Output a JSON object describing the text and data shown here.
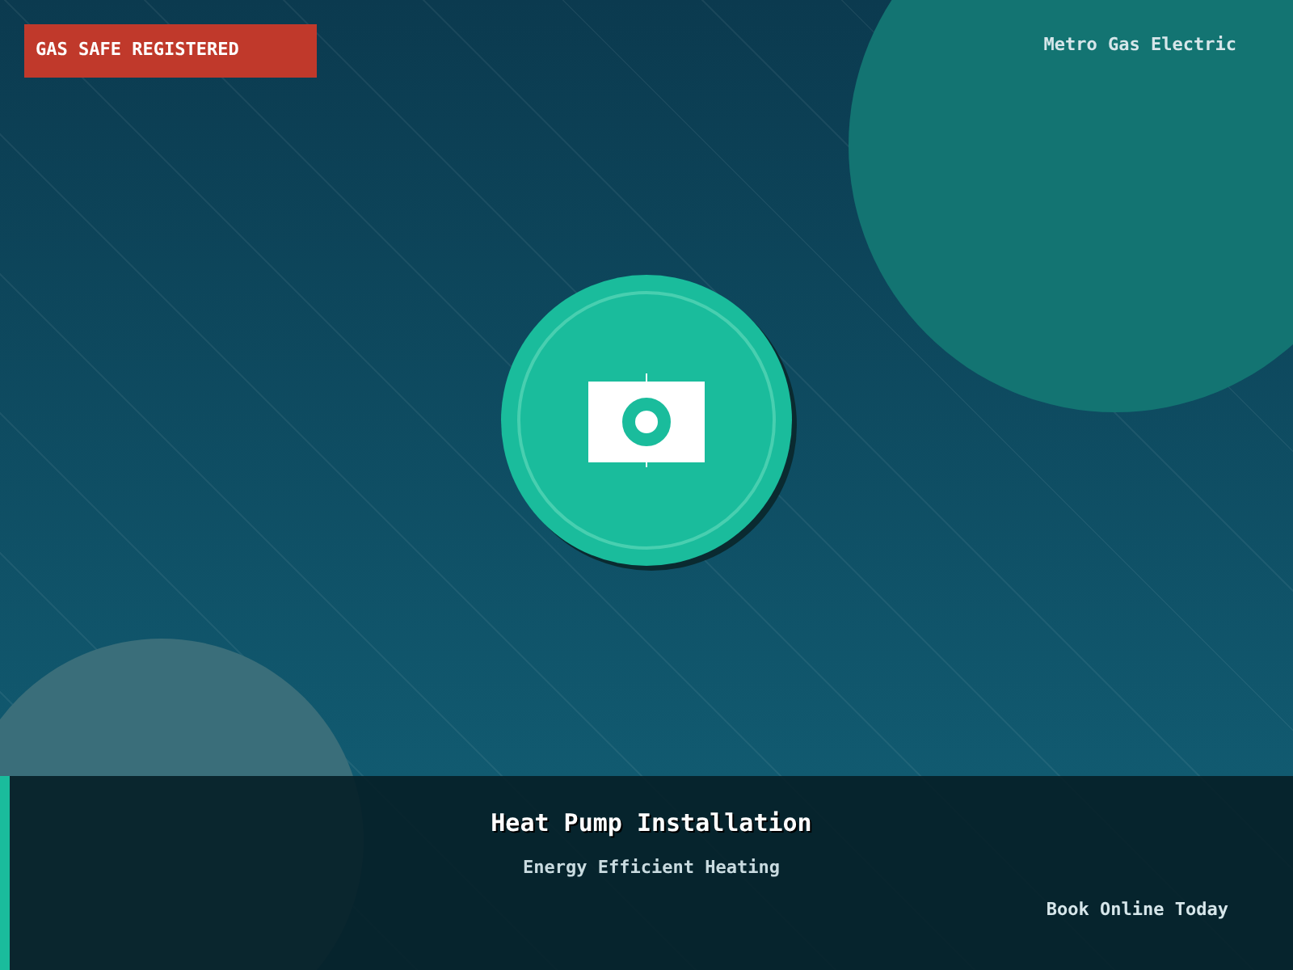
{
  "badge": "GAS SAFE REGISTERED",
  "brand": "Metro Gas Electric",
  "title": "Heat Pump Installation",
  "subtitle": "Energy Efficient Heating",
  "cta": "Book Online Today"
}
